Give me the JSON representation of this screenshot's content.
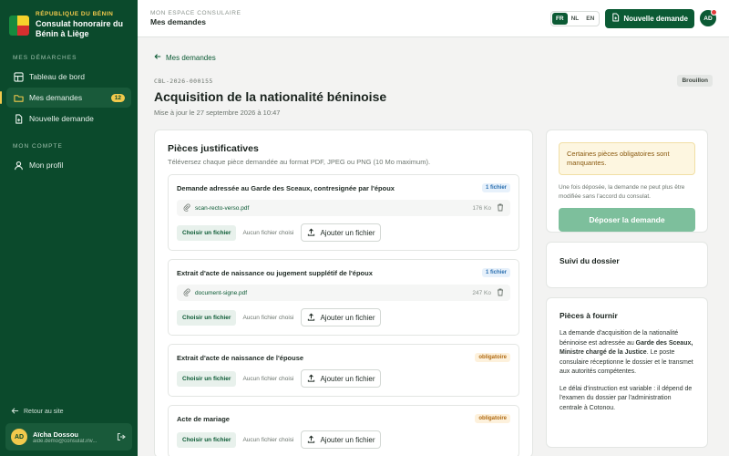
{
  "brand": {
    "kicker": "RÉPUBLIQUE DU BÉNIN",
    "name": "Consulat honoraire du Bénin à Liège"
  },
  "sidebar": {
    "section1": "MES DÉMARCHES",
    "items": [
      {
        "label": "Tableau de bord",
        "icon": "dashboard-icon"
      },
      {
        "label": "Mes demandes",
        "icon": "folder-icon",
        "badge": "12"
      },
      {
        "label": "Nouvelle demande",
        "icon": "file-plus-icon"
      }
    ],
    "section2": "MON COMPTE",
    "account_items": [
      {
        "label": "Mon profil",
        "icon": "user-icon"
      }
    ],
    "back_label": "Retour au site",
    "user": {
      "initials": "AD",
      "name": "Aïcha Dossou",
      "email": "aide.demo@consulat.inv..."
    }
  },
  "topbar": {
    "kicker": "MON ESPACE CONSULAIRE",
    "title": "Mes demandes",
    "languages": [
      "FR",
      "NL",
      "EN"
    ],
    "active_language": "FR",
    "new_request_label": "Nouvelle demande",
    "avatar_initials": "AD"
  },
  "page": {
    "breadcrumb": "Mes demandes",
    "reference": "CBL-2026-000155",
    "status": "Brouillon",
    "title": "Acquisition de la nationalité béninoise",
    "updated": "Mise à jour le 27 septembre 2026 à 10:47"
  },
  "documents": {
    "title": "Pièces justificatives",
    "subtitle": "Téléversez chaque pièce demandée au format PDF, JPEG ou PNG (10 Mo maximum).",
    "choose_label": "Choisir un fichier",
    "none_label": "Aucun fichier choisi",
    "add_label": "Ajouter un fichier",
    "pieces": [
      {
        "name": "Demande adressée au Garde des Sceaux, contresignée par l'époux",
        "tag": "1 fichier",
        "tag_kind": "ok",
        "file": "scan-recto-verso.pdf",
        "size": "176 Ko"
      },
      {
        "name": "Extrait d'acte de naissance ou jugement supplétif de l'époux",
        "tag": "1 fichier",
        "tag_kind": "ok",
        "file": "document-signe.pdf",
        "size": "247 Ko"
      },
      {
        "name": "Extrait d'acte de naissance de l'épouse",
        "tag": "obligatoire",
        "tag_kind": "req"
      },
      {
        "name": "Acte de mariage",
        "tag": "obligatoire",
        "tag_kind": "req"
      }
    ]
  },
  "submit": {
    "warning": "Certaines pièces obligatoires sont manquantes.",
    "hint": "Une fois déposée, la demande ne peut plus être modifiée sans l'accord du consulat.",
    "button": "Déposer la demande"
  },
  "follow": {
    "title": "Suivi du dossier"
  },
  "required": {
    "title": "Pièces à fournir",
    "p1_a": "La demande d'acquisition de la nationalité béninoise est adressée au ",
    "p1_b": "Garde des Sceaux, Ministre chargé de la Justice",
    "p1_c": ". Le poste consulaire réceptionne le dossier et le transmet aux autorités compétentes.",
    "p2": "Le délai d'instruction est variable : il dépend de l'examen du dossier par l'administration centrale à Cotonou."
  },
  "colors": {
    "sidebar": "#0b4a2c",
    "accent": "#0b5a34",
    "gold": "#f2c94c"
  }
}
